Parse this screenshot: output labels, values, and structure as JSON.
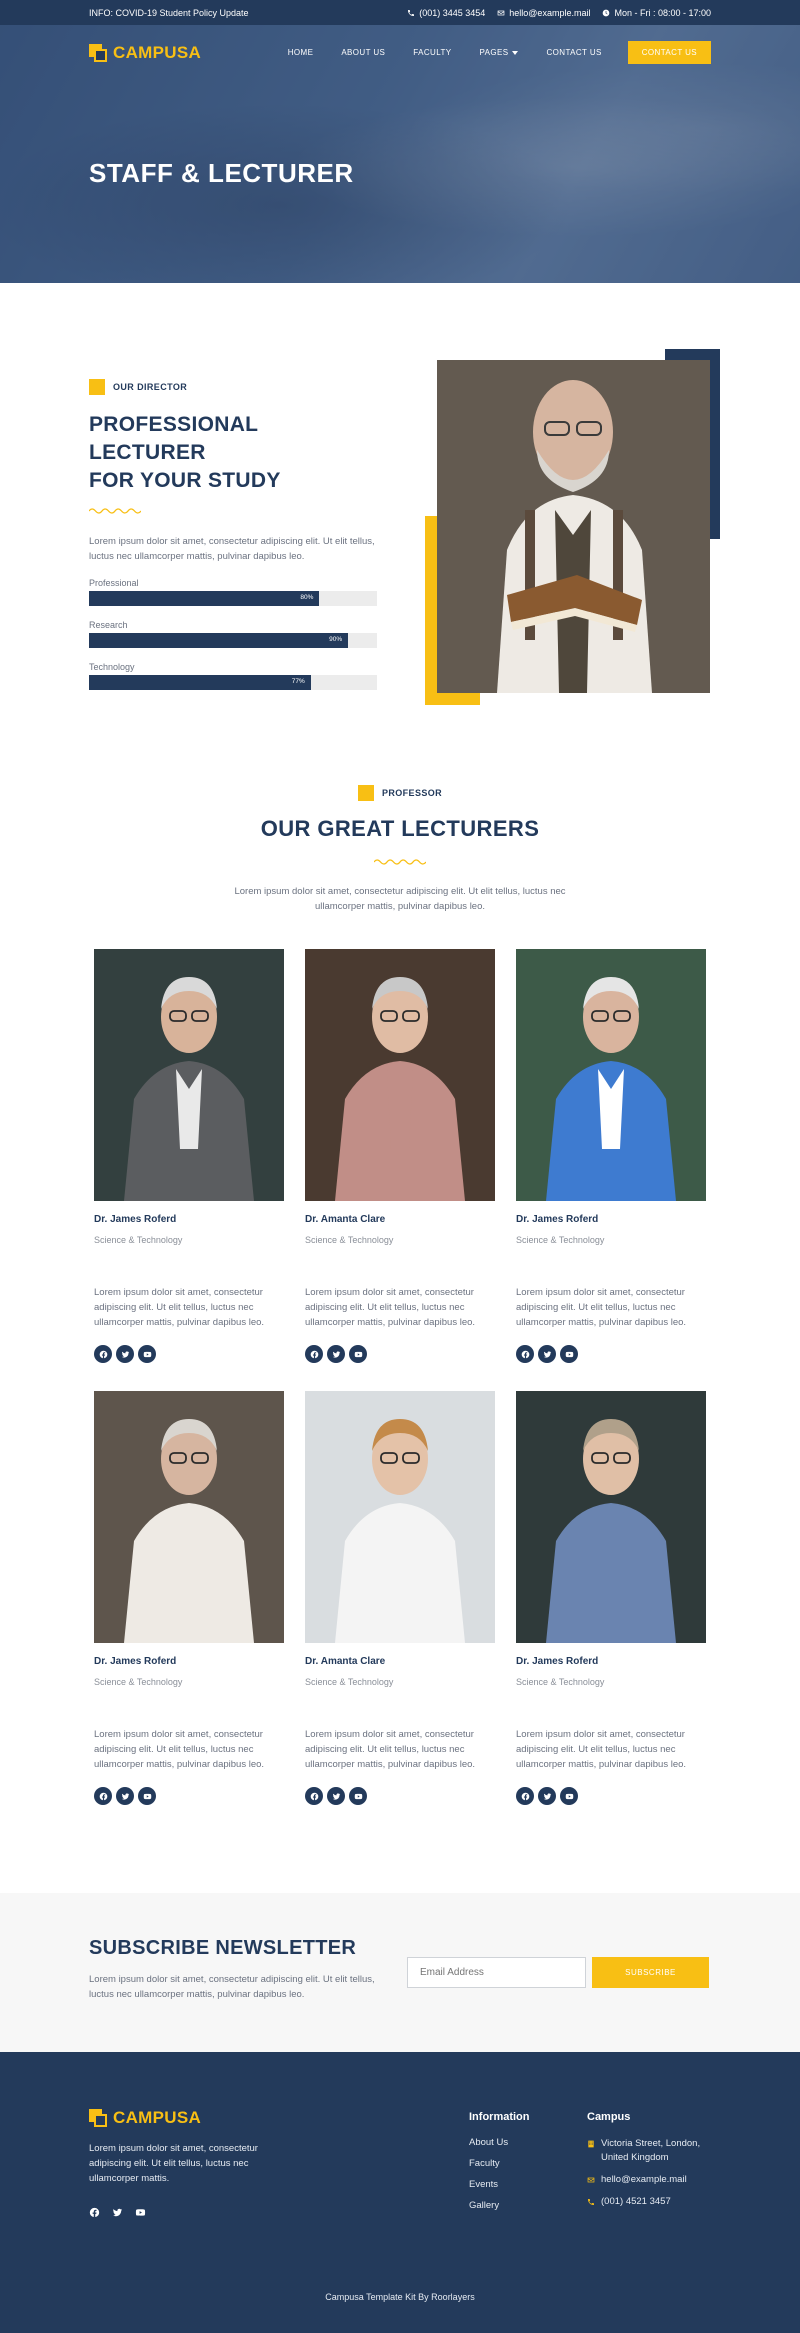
{
  "topbar": {
    "info": "INFO: COVID-19 Student Policy Update",
    "phone": "(001) 3445 3454",
    "email": "hello@example.mail",
    "hours": "Mon - Fri : 08:00 - 17:00"
  },
  "brand": {
    "name": "CAMPUSA"
  },
  "nav": {
    "items": [
      "HOME",
      "ABOUT US",
      "FACULTY",
      "PAGES",
      "CONTACT US"
    ],
    "cta": "CONTACT US"
  },
  "hero": {
    "title": "STAFF & LECTURER"
  },
  "director": {
    "eyebrow": "OUR DIRECTOR",
    "title_line1": "PROFESSIONAL LECTURER",
    "title_line2": "FOR YOUR STUDY",
    "description": "Lorem ipsum dolor sit amet, consectetur adipiscing elit. Ut elit tellus, luctus nec ullamcorper mattis, pulvinar dapibus leo.",
    "skills": [
      {
        "label": "Professional",
        "percent": 80,
        "text": "80%"
      },
      {
        "label": "Research",
        "percent": 90,
        "text": "90%"
      },
      {
        "label": "Technology",
        "percent": 77,
        "text": "77%"
      }
    ]
  },
  "lecturers": {
    "eyebrow": "PROFESSOR",
    "title": "OUR GREAT LECTURERS",
    "description": "Lorem ipsum dolor sit amet, consectetur adipiscing elit. Ut elit tellus, luctus nec ullamcorper mattis, pulvinar dapibus leo.",
    "cards": [
      {
        "name": "Dr. James Roferd",
        "role": "Science & Technology",
        "bio": "Lorem ipsum dolor sit amet, consectetur adipiscing elit. Ut elit tellus, luctus nec ullamcorper mattis, pulvinar dapibus leo."
      },
      {
        "name": "Dr. Amanta Clare",
        "role": "Science & Technology",
        "bio": "Lorem ipsum dolor sit amet, consectetur adipiscing elit. Ut elit tellus, luctus nec ullamcorper mattis, pulvinar dapibus leo."
      },
      {
        "name": "Dr. James Roferd",
        "role": "Science & Technology",
        "bio": "Lorem ipsum dolor sit amet, consectetur adipiscing elit. Ut elit tellus, luctus nec ullamcorper mattis, pulvinar dapibus leo."
      },
      {
        "name": "Dr. James Roferd",
        "role": "Science & Technology",
        "bio": "Lorem ipsum dolor sit amet, consectetur adipiscing elit. Ut elit tellus, luctus nec ullamcorper mattis, pulvinar dapibus leo."
      },
      {
        "name": "Dr. Amanta Clare",
        "role": "Science & Technology",
        "bio": "Lorem ipsum dolor sit amet, consectetur adipiscing elit. Ut elit tellus, luctus nec ullamcorper mattis, pulvinar dapibus leo."
      },
      {
        "name": "Dr. James Roferd",
        "role": "Science & Technology",
        "bio": "Lorem ipsum dolor sit amet, consectetur adipiscing elit. Ut elit tellus, luctus nec ullamcorper mattis, pulvinar dapibus leo."
      }
    ]
  },
  "newsletter": {
    "title": "SUBSCRIBE NEWSLETTER",
    "description": "Lorem ipsum dolor sit amet, consectetur adipiscing elit. Ut elit tellus, luctus nec ullamcorper mattis, pulvinar dapibus leo.",
    "placeholder": "Email Address",
    "button": "SUBSCRIBE"
  },
  "footer": {
    "about": "Lorem ipsum dolor sit amet, consectetur adipiscing elit. Ut elit tellus, luctus nec ullamcorper mattis.",
    "info_title": "Information",
    "info_links": [
      "About Us",
      "Faculty",
      "Events",
      "Gallery"
    ],
    "campus_title": "Campus",
    "address": "Victoria Street, London, United Kingdom",
    "email": "hello@example.mail",
    "phone": "(001) 4521 3457",
    "copyright": "Campusa Template Kit By Roorlayers"
  },
  "colors": {
    "navy": "#233a5b",
    "accent": "#f8bf14"
  },
  "icons": [
    "phone-icon",
    "mail-icon",
    "clock-icon",
    "facebook-icon",
    "twitter-icon",
    "youtube-icon",
    "map-pin-icon",
    "caret-down-icon"
  ]
}
